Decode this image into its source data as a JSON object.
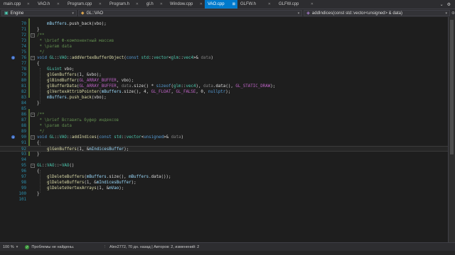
{
  "tabs": [
    {
      "label": "main.cpp",
      "active": false
    },
    {
      "label": "VAO.h",
      "active": false
    },
    {
      "label": "Program.cpp",
      "active": false
    },
    {
      "label": "Program.h",
      "active": false
    },
    {
      "label": "gl.h",
      "active": false
    },
    {
      "label": "Window.cpp",
      "active": false
    },
    {
      "label": "VAO.cpp",
      "active": true
    },
    {
      "label": "GLFW.h",
      "active": false
    },
    {
      "label": "GLFW.cpp",
      "active": false
    }
  ],
  "navbar": {
    "project": "Engine",
    "scope": "GL::VAO",
    "member": "addIndices(const std::vector<unsigned> & data)"
  },
  "lines": [
    {
      "n": "70",
      "code": "    mBuffers.push_back(vbo);"
    },
    {
      "n": "71",
      "code": "}"
    },
    {
      "n": "72",
      "code": "/**"
    },
    {
      "n": "73",
      "code": " * \\brief Ф-компонентный массив"
    },
    {
      "n": "74",
      "code": " * \\param data"
    },
    {
      "n": "75",
      "code": " */"
    },
    {
      "n": "76",
      "code": "void GL::VAO::addVertexBufferObject(const std::vector<glm::vec4>& data)"
    },
    {
      "n": "77",
      "code": "{"
    },
    {
      "n": "78",
      "code": "    GLuint vbo;"
    },
    {
      "n": "79",
      "code": "    glGenBuffers(1, &vbo);"
    },
    {
      "n": "80",
      "code": "    glBindBuffer(GL_ARRAY_BUFFER, vbo);"
    },
    {
      "n": "81",
      "code": "    glBufferData(GL_ARRAY_BUFFER, data.size() * sizeof(glm::vec4), data.data(), GL_STATIC_DRAW);"
    },
    {
      "n": "82",
      "code": "    glVertexAttribPointer(mBuffers.size(), 4, GL_FLOAT, GL_FALSE, 0, nullptr);"
    },
    {
      "n": "83",
      "code": "    mBuffers.push_back(vbo);"
    },
    {
      "n": "84",
      "code": "}"
    },
    {
      "n": "85",
      "code": ""
    },
    {
      "n": "86",
      "code": "/**"
    },
    {
      "n": "87",
      "code": " * \\brief Вставить буфер индексов"
    },
    {
      "n": "88",
      "code": " * \\param data"
    },
    {
      "n": "89",
      "code": " */"
    },
    {
      "n": "90",
      "code": "void GL::VAO::addIndices(const std::vector<unsigned>& data)"
    },
    {
      "n": "91",
      "code": "{"
    },
    {
      "n": "92",
      "code": "    glGenBuffers(1, &mIndicesBuffer);"
    },
    {
      "n": "93",
      "code": "}"
    },
    {
      "n": "94",
      "code": ""
    },
    {
      "n": "95",
      "code": "GL::VAO::~VAO()"
    },
    {
      "n": "96",
      "code": "{"
    },
    {
      "n": "97",
      "code": "    glDeleteBuffers(mBuffers.size(), mBuffers.data());"
    },
    {
      "n": "98",
      "code": "    glDeleteBuffers(1, &mIndicesBuffer);"
    },
    {
      "n": "99",
      "code": "    glDeleteVertexArrays(1, &mVao);"
    },
    {
      "n": "100",
      "code": "}"
    },
    {
      "n": "101",
      "code": ""
    }
  ],
  "status": {
    "zoom": "100 %",
    "issues": "Проблемы не найдены.",
    "blame": "Alex2772, 70 дн. назад | Авторов: 2, изменений: 2"
  },
  "colors": {
    "accent": "#007acc",
    "editor_bg": "#1e1e1e",
    "chrome_bg": "#2d2d30"
  }
}
